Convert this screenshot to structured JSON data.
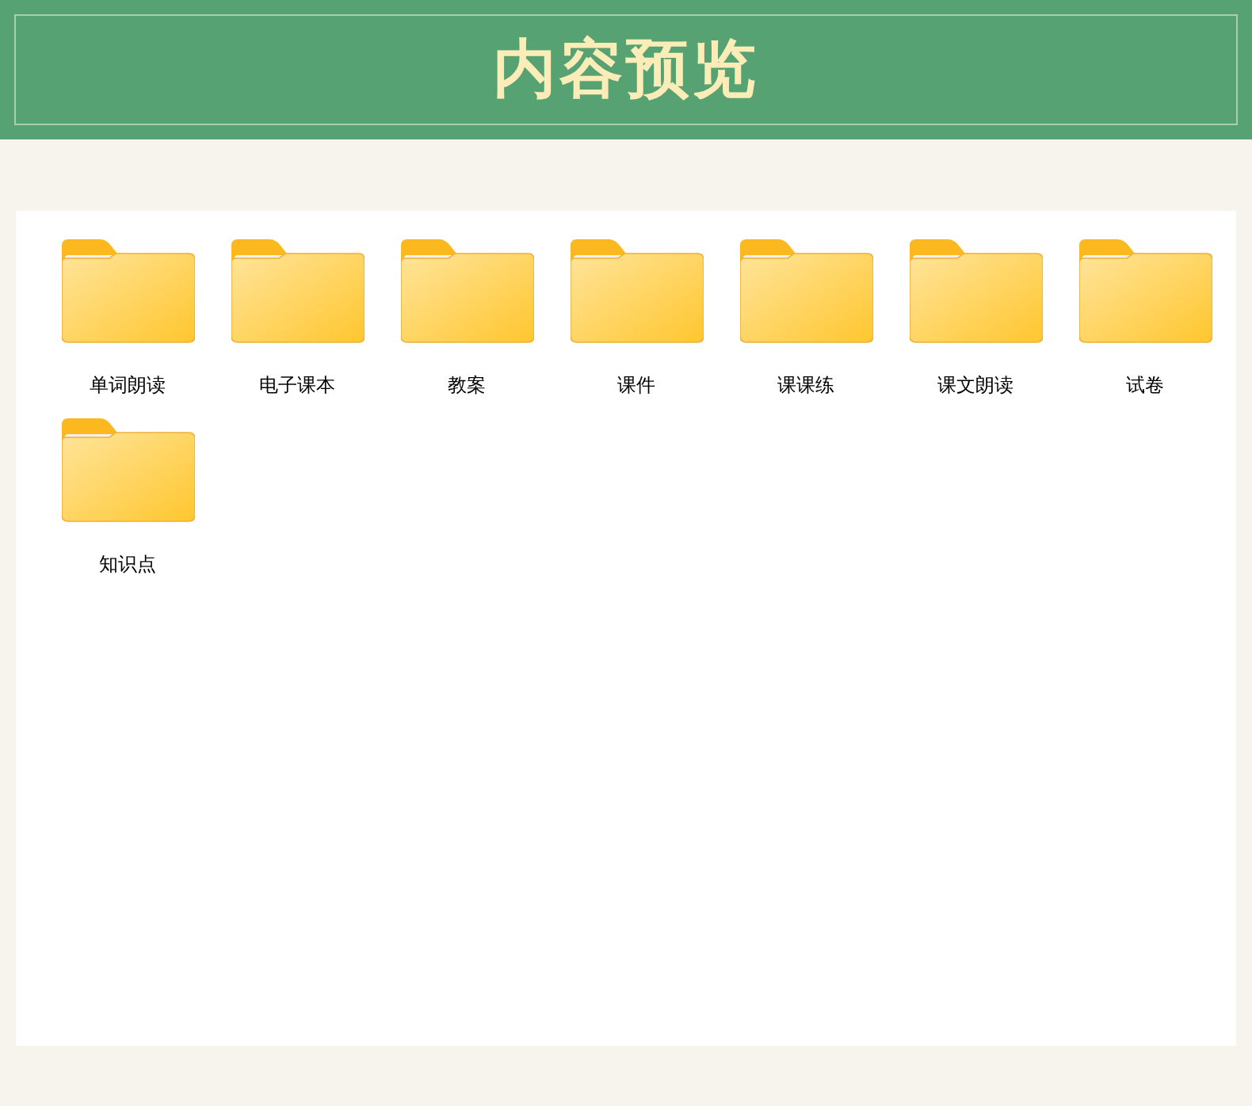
{
  "header": {
    "title": "内容预览"
  },
  "folders": [
    {
      "label": "单词朗读"
    },
    {
      "label": "电子课本"
    },
    {
      "label": "教案"
    },
    {
      "label": "课件"
    },
    {
      "label": "课课练"
    },
    {
      "label": "课文朗读"
    },
    {
      "label": "试卷"
    },
    {
      "label": "知识点"
    }
  ]
}
